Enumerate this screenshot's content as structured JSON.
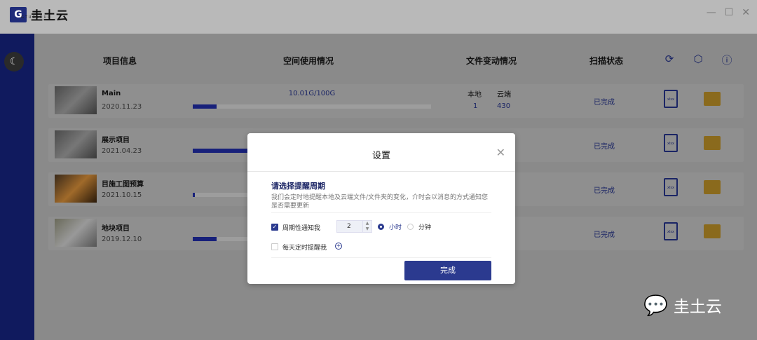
{
  "app": {
    "brand": "圭土云",
    "brand_sub": "GTUCLOUD",
    "minimize": "—",
    "maximize": "☐",
    "close": "✕"
  },
  "columns": {
    "info": "项目信息",
    "space": "空间使用情况",
    "files": "文件变动情况",
    "scan": "扫描状态"
  },
  "toolbar_icons": [
    "refresh-icon",
    "settings-icon",
    "help-icon"
  ],
  "rows": [
    {
      "name": "Main",
      "date": "2020.11.23",
      "usage": "10.01G/100G",
      "progress": 0.1,
      "local_label": "本地",
      "cloud_label": "云端",
      "local": "1",
      "cloud": "430",
      "status": "已完成"
    },
    {
      "name": "展示项目",
      "date": "2021.04.23",
      "usage": "",
      "progress": 0.25,
      "local_label": "",
      "cloud_label": "",
      "local": "",
      "cloud": "",
      "status": "已完成"
    },
    {
      "name": "目施工图预算",
      "date": "2021.10.15",
      "usage": "",
      "progress": 0.01,
      "local_label": "",
      "cloud_label": "",
      "local": "",
      "cloud": "",
      "status": "已完成"
    },
    {
      "name": "地块项目",
      "date": "2019.12.10",
      "usage": "",
      "progress": 0.1,
      "local_label": "",
      "cloud_label": "",
      "local": "",
      "cloud": "",
      "status": "已完成"
    }
  ],
  "dialog": {
    "title": "设置",
    "close": "✕",
    "heading": "请选择提醒周期",
    "description": "我们会定时地提醒本地及云端文件/文件夹的变化，介时会以消息的方式通知您是否需要更新",
    "periodic_label": "周期性通知我",
    "periodic_checked": true,
    "interval_value": "2",
    "unit_hour": "小时",
    "unit_minute": "分钟",
    "unit_selected": "小时",
    "daily_label": "每天定时提醒我",
    "daily_checked": false,
    "done_label": "完成",
    "accent": "#2b3a8f"
  },
  "watermark": {
    "text": "圭土云"
  }
}
